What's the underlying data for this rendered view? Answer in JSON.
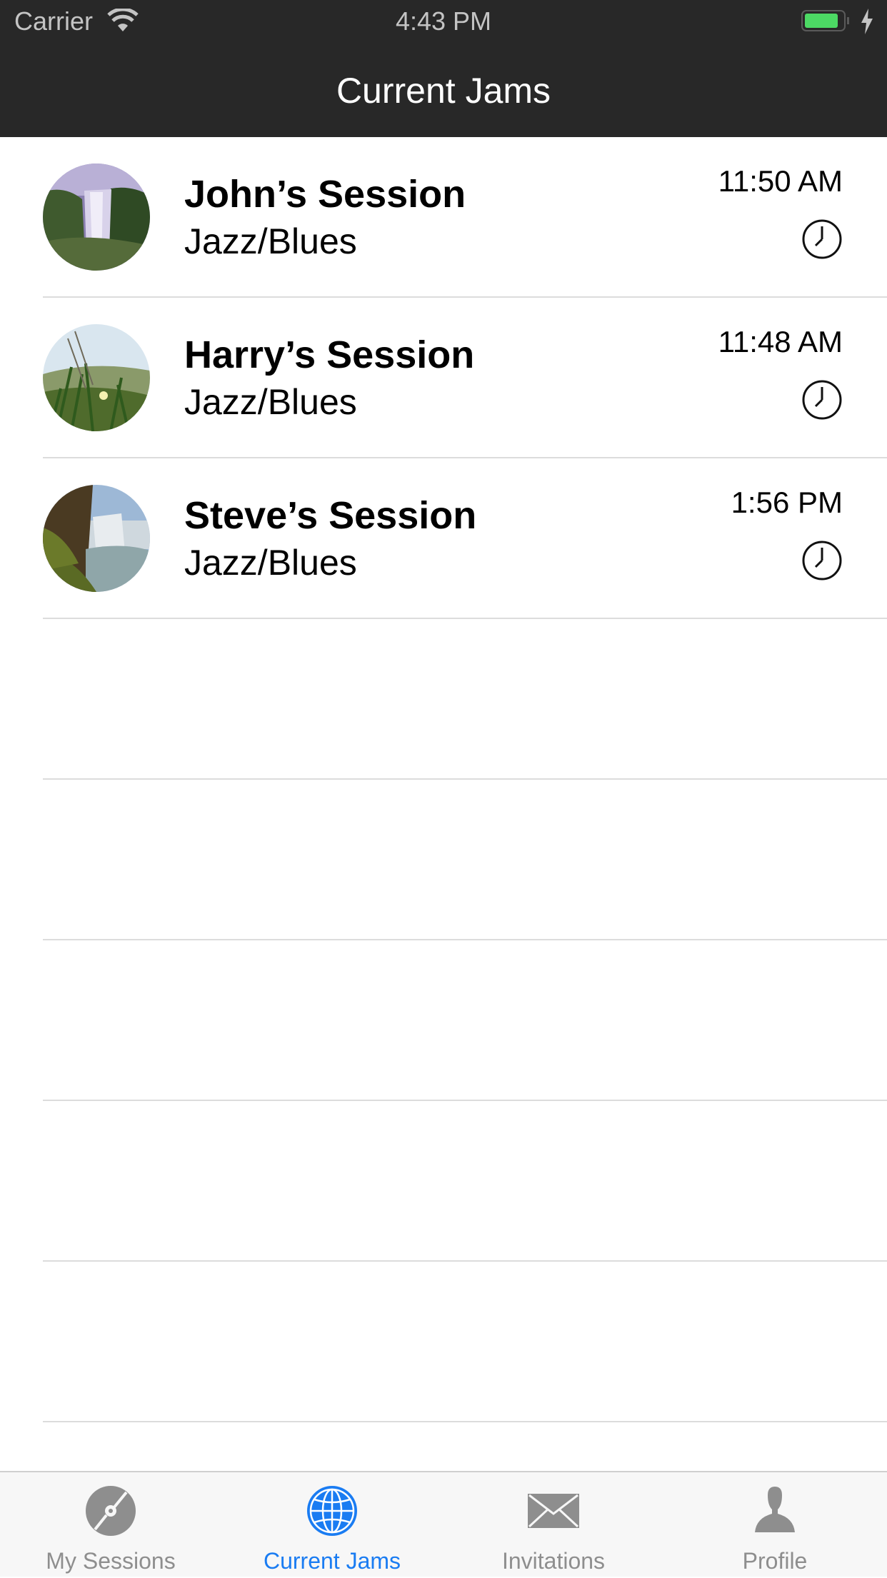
{
  "status_bar": {
    "carrier": "Carrier",
    "time": "4:43 PM",
    "battery_color": "#4cd964"
  },
  "nav": {
    "title": "Current Jams"
  },
  "sessions": [
    {
      "title": "John’s Session",
      "genre": "Jazz/Blues",
      "time": "11:50 AM",
      "avatar": "waterfall-photo"
    },
    {
      "title": "Harry’s Session",
      "genre": "Jazz/Blues",
      "time": "11:48 AM",
      "avatar": "grass-flower-photo"
    },
    {
      "title": "Steve’s Session",
      "genre": "Jazz/Blues",
      "time": "1:56 PM",
      "avatar": "coastal-waterfall-photo"
    }
  ],
  "tabs": [
    {
      "label": "My Sessions",
      "icon": "disc-icon",
      "active": false
    },
    {
      "label": "Current Jams",
      "icon": "globe-icon",
      "active": true
    },
    {
      "label": "Invitations",
      "icon": "envelope-icon",
      "active": false
    },
    {
      "label": "Profile",
      "icon": "person-icon",
      "active": false
    }
  ],
  "colors": {
    "accent": "#1a7cf2",
    "nav_background": "#282828",
    "tab_inactive": "#8e8e8e"
  }
}
